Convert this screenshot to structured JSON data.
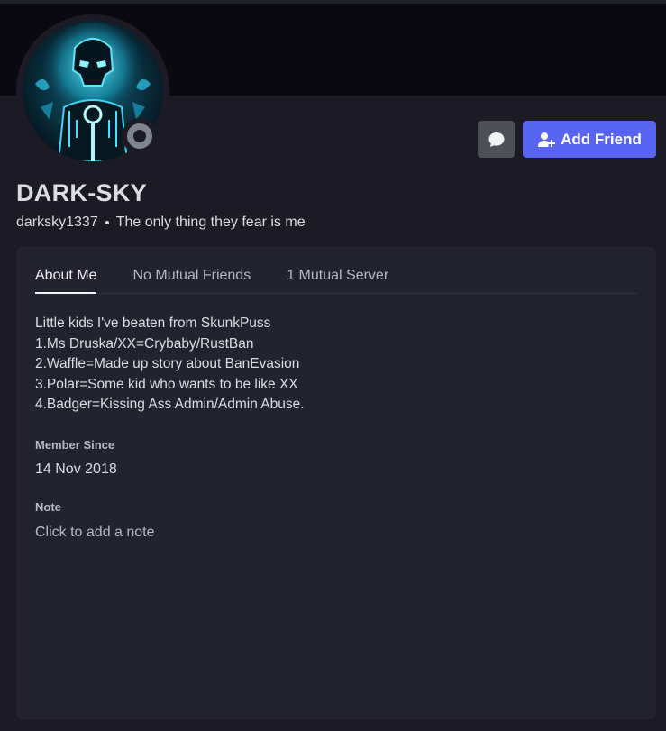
{
  "user": {
    "display_name": "DARK-SKY",
    "username": "darksky1337",
    "custom_status": "The only thing they fear is me",
    "status": "offline"
  },
  "actions": {
    "message_icon": "chat-bubble-icon",
    "add_friend_icon": "add-person-icon",
    "add_friend_label": "Add Friend"
  },
  "tabs": [
    {
      "label": "About Me",
      "active": true
    },
    {
      "label": "No Mutual Friends",
      "active": false
    },
    {
      "label": "1 Mutual Server",
      "active": false
    }
  ],
  "about": {
    "lines": [
      "Little kids I've beaten from SkunkPuss",
      "1.Ms Druska/XX=Crybaby/RustBan",
      "2.Waffle=Made up story about BanEvasion",
      "3.Polar=Some kid who wants to be like XX",
      "4.Badger=Kissing Ass Admin/Admin Abuse."
    ]
  },
  "member_since": {
    "title": "Member Since",
    "date": "14 Nov 2018"
  },
  "note": {
    "title": "Note",
    "placeholder": "Click to add a note"
  },
  "colors": {
    "accent": "#5865f2",
    "offline": "#80848e",
    "panel": "#232330",
    "background": "#1b1a25"
  }
}
